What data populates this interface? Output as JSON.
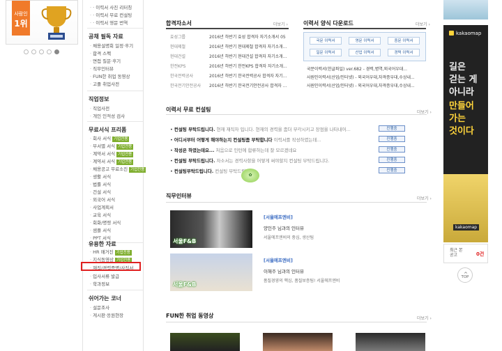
{
  "banner": {
    "ribbon_small": "사람인",
    "ribbon_big": "1위"
  },
  "nav": {
    "items_top": [
      "· 이력서 사진 리터칭",
      "· 이력서 무료 컨설팅",
      "· 이력서 영문 번역"
    ],
    "sections": [
      {
        "title": "공채 필독 자료",
        "items": [
          "채용설명회 일정·후기",
          "합격 스펙",
          "면접 질문·후기",
          "직무인터뷰",
          "FUN한 취업 동영상",
          "고졸 취업사전"
        ]
      },
      {
        "title": "직업정보",
        "items": [
          "직업사전",
          "개인 인적성 검사"
        ]
      },
      {
        "title": "무료서식 프리폼",
        "items": [
          {
            "label": "회사 서식",
            "badge": "기업전용"
          },
          {
            "label": "부서별 서식",
            "badge": "기업전용"
          },
          {
            "label": "계약서 서식",
            "badge": "기업전용"
          },
          {
            "label": "계약서 서식",
            "badge": "기업전용"
          },
          {
            "label": "채용공고 무료소진",
            "badge": "기업전용"
          },
          {
            "label": "생활 서식",
            "badge": ""
          },
          {
            "label": "법률 서식",
            "badge": ""
          },
          {
            "label": "건설 서식",
            "badge": ""
          },
          {
            "label": "외국어 서식",
            "badge": ""
          },
          {
            "label": "사업계획서",
            "badge": ""
          },
          {
            "label": "교육 서식",
            "badge": ""
          },
          {
            "label": "회화/명령 서식",
            "badge": ""
          },
          {
            "label": "샘플 서식",
            "badge": ""
          },
          {
            "label": "PPT 서식",
            "badge": ""
          }
        ]
      },
      {
        "title": "유용한 자료",
        "items": [
          {
            "label": "HR 매거진",
            "badge": "기업전용"
          },
          {
            "label": "지식동영상",
            "badge": "기업전용"
          },
          {
            "label": "재직/경력증명/사직서",
            "badge": ""
          },
          {
            "label": "입사서류 발급",
            "badge": ""
          },
          {
            "label": "학과정보",
            "badge": ""
          }
        ]
      },
      {
        "title": "쉬어가는 코너",
        "items": [
          "설문조사",
          "게시판·응원현장"
        ]
      }
    ]
  },
  "passed": {
    "title": "합격자소서",
    "more": "더보기",
    "rows": [
      {
        "company": "효성그룹",
        "text": "2016년 하반기 효성 합격자 자기소개서 05"
      },
      {
        "company": "현대제철",
        "text": "2016년 하반기 현대제철 합격자 자기소개..."
      },
      {
        "company": "현대건설",
        "text": "2016년 하반기 현대건설 합격자 자기소개..."
      },
      {
        "company": "한전KPS",
        "text": "2016년 하반기 한전KPS 합격자 자기소개..."
      },
      {
        "company": "한국전력공사",
        "text": "2016년 하반기 한국전력공사 합격자 자기..."
      },
      {
        "company": "한국전기안전공사",
        "text": "2016년 하반기 한국전기안전공사 합격자 ..."
      }
    ]
  },
  "download": {
    "title": "이력서 양식 다운로드",
    "more": "더보기",
    "buttons": [
      "국문 이력서",
      "영문 이력서",
      "중문 이력서",
      "일문 이력서",
      "산업 이력서",
      "경력 이력서"
    ],
    "rows": [
      "국문이력서(한글파일) ver.682 - 경력,병역,외국어우대...",
      "사원인이력서(산업/인터넷) - 외국어우대,자격증우대,수상내...",
      "사원인이력서(산업/인터넷) - 외국어우대,자격증우대,수상내..."
    ]
  },
  "consult": {
    "title": "이력서 무료 컨설팅",
    "more": "더보기",
    "rows": [
      {
        "bold": "컨설팅 부탁드립니다.",
        "gray": "현재 재직자 입니다. 현재의 경력을 좀더 부각시키고 장점을 나타내어...",
        "btn": "진행중"
      },
      {
        "bold": "어디서부터 어떻게 해야하는지 컨설팅좀 부탁합니다",
        "gray": "이력서를 작성하였는데...",
        "btn": "진행중"
      },
      {
        "bold": "작성은 하였는데요...",
        "gray": "처음으로 인턴에 합류하는데 잘 모르겠네요",
        "btn": "진행중"
      },
      {
        "bold": "컨설팅 부탁드립니다.",
        "gray": "자소서는 경력사항을 어떻게 써야할지 컨설팅 부탁드립니다.",
        "btn": "진행중"
      },
      {
        "bold": "컨설팅부탁드립니다.",
        "gray": "컨설팅 부탁드립니다.",
        "btn": "진행중"
      }
    ]
  },
  "interview": {
    "title": "직무인터뷰",
    "more": "더보기",
    "items": [
      {
        "tag": "[서울에프엔비]",
        "title": "양인주 님과의 인터뷰",
        "sub": "서울에프엔비의 중심, 생산팀",
        "thumb_label": "서울F&B"
      },
      {
        "tag": "[서울에프엔비]",
        "title": "이해주 님과의 인터뷰",
        "sub": "품질경영의 핵심, 품질보증팀! 서울에프엔비",
        "thumb_label": "서울F&B"
      }
    ]
  },
  "fun_video": {
    "title": "FUN한 취업 동영상",
    "more": "더보기"
  },
  "right_ad": {
    "brand": "kakaomap",
    "line1": [
      "길은",
      "걷는 게",
      "아니라"
    ],
    "line2": [
      "만들어",
      "가는",
      "것이다"
    ],
    "sign": "kakaomap"
  },
  "recent": {
    "label1": "최근 본",
    "label2": "공고",
    "count": "0건"
  },
  "top_button": "TOP"
}
